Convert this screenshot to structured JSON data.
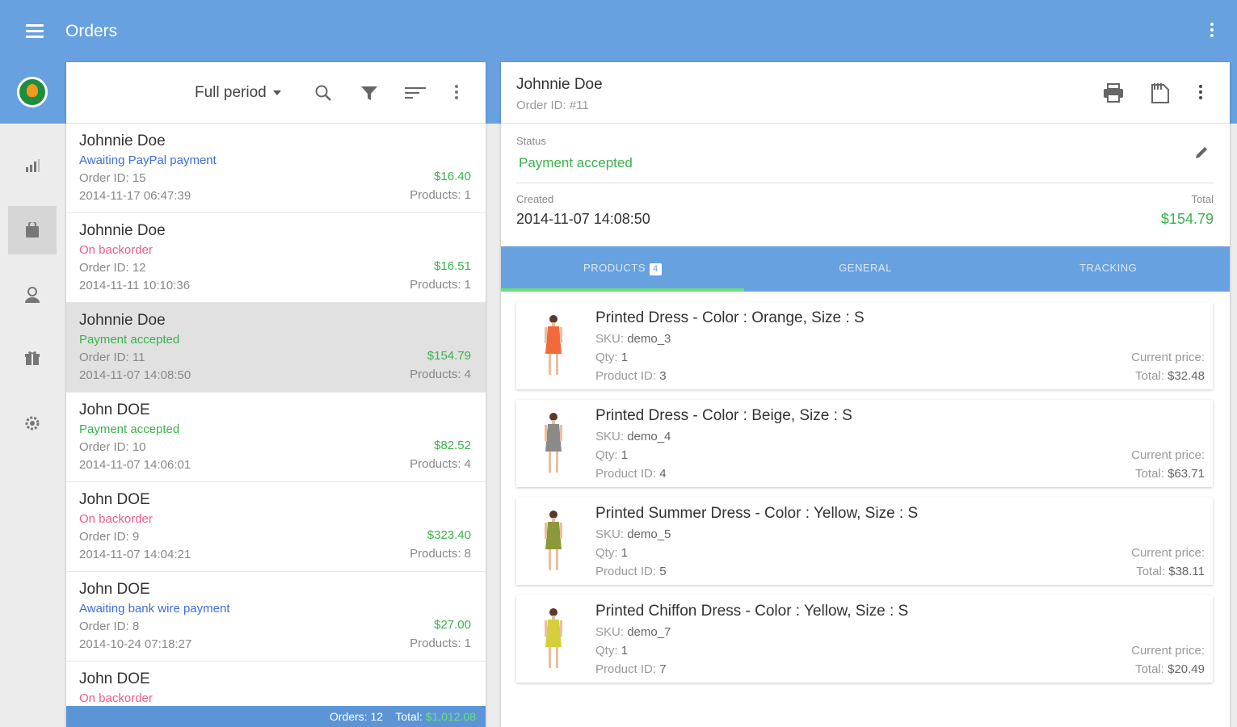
{
  "app": {
    "title": "Orders"
  },
  "colors": {
    "primary": "#68a1e0",
    "accent_green": "#3ab34a",
    "status_pink": "#ee5a8e",
    "status_blue": "#3d6fd9"
  },
  "rail": {
    "icons": [
      "app-logo-icon",
      "stats-icon",
      "orders-icon",
      "customers-icon",
      "products-icon",
      "settings-icon"
    ]
  },
  "list": {
    "period": "Full period",
    "orders": [
      {
        "name": "Johnnie Doe",
        "status": "Awaiting PayPal payment",
        "status_color": "#3d6fd9",
        "order_id": "Order ID: 15",
        "date": "2014-11-17 06:47:39",
        "price": "$16.40",
        "products": "Products: 1"
      },
      {
        "name": "Johnnie Doe",
        "status": "On backorder",
        "status_color": "#ee5a8e",
        "order_id": "Order ID: 12",
        "date": "2014-11-11 10:10:36",
        "price": "$16.51",
        "products": "Products: 1"
      },
      {
        "name": "Johnnie Doe",
        "status": "Payment accepted",
        "status_color": "#3ab34a",
        "order_id": "Order ID: 11",
        "date": "2014-11-07 14:08:50",
        "price": "$154.79",
        "products": "Products: 4"
      },
      {
        "name": "John DOE",
        "status": "Payment accepted",
        "status_color": "#3ab34a",
        "order_id": "Order ID: 10",
        "date": "2014-11-07 14:06:01",
        "price": "$82.52",
        "products": "Products: 4"
      },
      {
        "name": "John DOE",
        "status": "On backorder",
        "status_color": "#ee5a8e",
        "order_id": "Order ID: 9",
        "date": "2014-11-07 14:04:21",
        "price": "$323.40",
        "products": "Products: 8"
      },
      {
        "name": "John DOE",
        "status": "Awaiting bank wire payment",
        "status_color": "#3d6fd9",
        "order_id": "Order ID: 8",
        "date": "2014-10-24 07:18:27",
        "price": "$27.00",
        "products": "Products: 1"
      },
      {
        "name": "John DOE",
        "status": "On backorder",
        "status_color": "#ee5a8e",
        "order_id": "",
        "date": "",
        "price": "",
        "products": ""
      }
    ],
    "footer": {
      "orders": "Orders: 12",
      "total_label": "Total:",
      "total_value": "$1,012.08"
    }
  },
  "detail": {
    "name": "Johnnie Doe",
    "order_id": "Order ID: #11",
    "status_label": "Status",
    "status_value": "Payment accepted",
    "created_label": "Created",
    "created_value": "2014-11-07 14:08:50",
    "total_label": "Total",
    "total_value": "$154.79",
    "tabs": [
      {
        "label": "PRODUCTS",
        "badge": "4"
      },
      {
        "label": "GENERAL"
      },
      {
        "label": "TRACKING"
      }
    ],
    "products": [
      {
        "name": "Printed Dress - Color : Orange, Size : S",
        "sku_label": "SKU:",
        "sku": "demo_3",
        "qty_label": "Qty:",
        "qty": "1",
        "pid_label": "Product ID:",
        "pid": "3",
        "price_label": "Current price:",
        "total_label": "Total:",
        "total": "$32.48",
        "dress_color": "#f26a3c"
      },
      {
        "name": "Printed Dress - Color : Beige, Size : S",
        "sku_label": "SKU:",
        "sku": "demo_4",
        "qty_label": "Qty:",
        "qty": "1",
        "pid_label": "Product ID:",
        "pid": "4",
        "price_label": "Current price:",
        "total_label": "Total:",
        "total": "$63.71",
        "dress_color": "#8a8a86"
      },
      {
        "name": "Printed Summer Dress - Color : Yellow, Size : S",
        "sku_label": "SKU:",
        "sku": "demo_5",
        "qty_label": "Qty:",
        "qty": "1",
        "pid_label": "Product ID:",
        "pid": "5",
        "price_label": "Current price:",
        "total_label": "Total:",
        "total": "$38.11",
        "dress_color": "#8a9a3a"
      },
      {
        "name": "Printed Chiffon Dress - Color : Yellow, Size : S",
        "sku_label": "SKU:",
        "sku": "demo_7",
        "qty_label": "Qty:",
        "qty": "1",
        "pid_label": "Product ID:",
        "pid": "7",
        "price_label": "Current price:",
        "total_label": "Total:",
        "total": "$20.49",
        "dress_color": "#d4cf3a"
      }
    ]
  }
}
